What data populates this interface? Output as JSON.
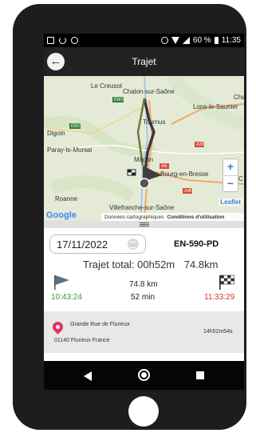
{
  "status_bar": {
    "battery_percent": "60 %",
    "time": "11:35",
    "left_icons": [
      "picture-icon",
      "sync-icon",
      "no-sim-icon"
    ],
    "right_icons": [
      "alarm-icon",
      "wifi-icon",
      "signal-icon",
      "battery-icon"
    ]
  },
  "app_bar": {
    "title": "Trajet",
    "back_icon": "back-arrow-icon"
  },
  "map": {
    "cities": [
      "Le Creusot",
      "Chalon-sur-Saône",
      "Lons-le-Saunier",
      "Tournus",
      "Digoin",
      "Paray-le-Monial",
      "Mâcon",
      "Bourg-en-Bresse",
      "Roanne",
      "Villefranche-sur-Saône",
      "Cha",
      "C"
    ],
    "roads": [
      "E607",
      "E607",
      "A39",
      "A6",
      "A40"
    ],
    "zoom_in": "+",
    "zoom_out": "−",
    "leaflet_label": "Leaflet",
    "google_label": "Google",
    "attribution": "Données cartographiques",
    "terms": "Conditions d'utilisation",
    "route_color": "#3a3a3a"
  },
  "trip": {
    "date": "17/11/2022",
    "plate": "EN-590-PD",
    "total_label": "Trajet total: 00h52m",
    "total_distance": "74.8km",
    "distance": "74.8 km",
    "duration": "52 min",
    "start_time": "10:43:24",
    "end_time": "11:33:29",
    "start_color": "#2e9e3a",
    "end_color": "#d9302f"
  },
  "address": {
    "street": "Grande Rue de Flurieux",
    "city": "01140 Flurieux France",
    "elapsed": "14h52m54s"
  },
  "nav_bar": {
    "icons": [
      "nav-back-icon",
      "nav-home-icon",
      "nav-recent-icon"
    ]
  }
}
